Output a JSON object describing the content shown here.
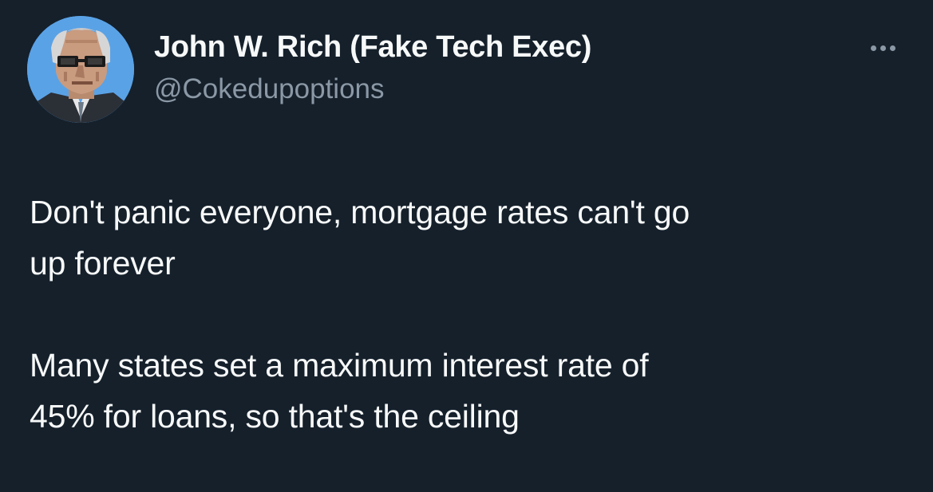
{
  "author": {
    "display_name": "John W. Rich (Fake Tech Exec)",
    "handle": "@Cokedupoptions",
    "avatar_icon": "pixel-art-old-man-avatar"
  },
  "menu": {
    "icon": "more-horizontal-icon"
  },
  "tweet": {
    "paragraphs": [
      "Don't panic everyone, mortgage rates can't go\nup forever",
      "Many states set a maximum interest rate of\n45% for loans, so that's the ceiling"
    ]
  },
  "colors": {
    "background": "#15202b",
    "text": "#f7f9f9",
    "secondary_text": "#8b98a5",
    "avatar_bg": "#5aa2e6"
  }
}
